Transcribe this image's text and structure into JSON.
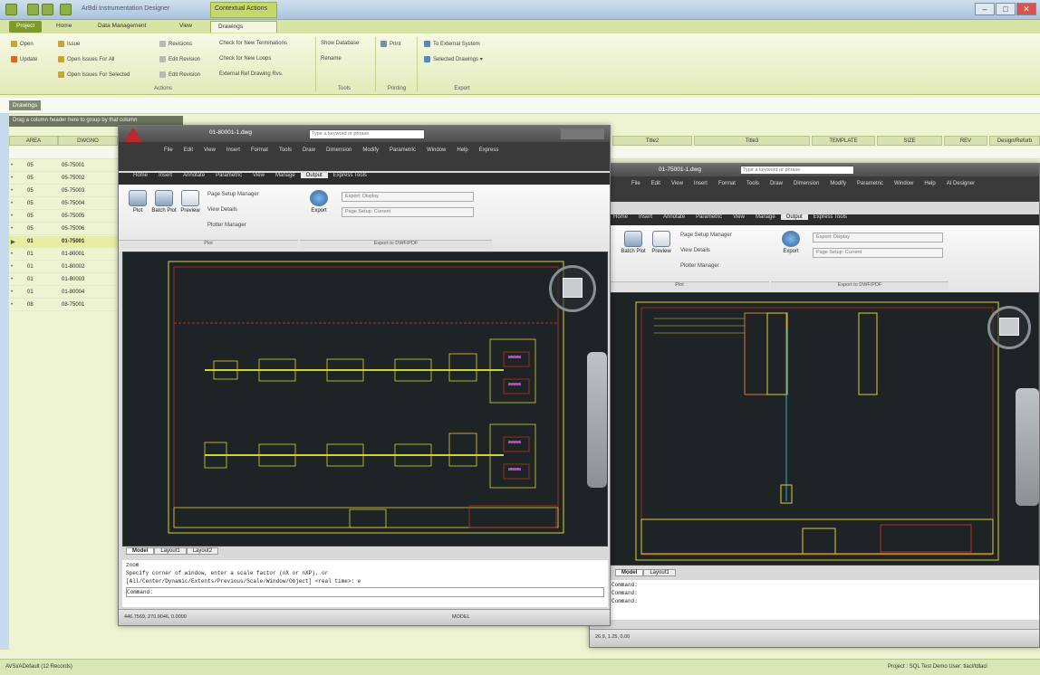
{
  "app": {
    "title": "ArBdi Instrumentation Designer",
    "contextual_tab": "Contextual Actions",
    "minimize": "–",
    "maximize": "□",
    "close": "✕"
  },
  "tabs": [
    "Project",
    "Home",
    "Data Management",
    "View",
    "Drawings"
  ],
  "ribbon": {
    "col1": [
      "Open",
      "Update"
    ],
    "col2": [
      "Issue",
      "Open Issues For All",
      "Open Issues For Selected"
    ],
    "col3": [
      "Revisions",
      "Edit Revision",
      "Edit Revision"
    ],
    "col4": [
      "Check for New Terminations",
      "Check for New Loops",
      "External Ref Drawing Rvs."
    ],
    "col5": [
      "Show Database",
      "Rename"
    ],
    "col6": [
      "Print"
    ],
    "col7": [
      "To External System",
      "Selected Drawings ▾"
    ],
    "groups": [
      "Actions",
      "Tools",
      "Printing",
      "Export"
    ]
  },
  "drawings_tab": "Drawings",
  "group_hint": "Drag a column header here to group by that column",
  "grid": {
    "headers_left": [
      "AREA",
      "DWGNO"
    ],
    "headers_right": [
      "Title2",
      "Title3",
      "TEMPLATE",
      "SIZE",
      "REV",
      "Design/Refurb"
    ],
    "rows": [
      {
        "area": "05",
        "dwg": "05-75001",
        "selected": false
      },
      {
        "area": "05",
        "dwg": "05-75002",
        "selected": false
      },
      {
        "area": "05",
        "dwg": "05-75003",
        "selected": false
      },
      {
        "area": "05",
        "dwg": "05-75004",
        "selected": false
      },
      {
        "area": "05",
        "dwg": "05-75005",
        "selected": false
      },
      {
        "area": "05",
        "dwg": "05-75006",
        "selected": false
      },
      {
        "area": "01",
        "dwg": "01-75001",
        "selected": true
      },
      {
        "area": "01",
        "dwg": "01-80001",
        "selected": false
      },
      {
        "area": "01",
        "dwg": "01-80002",
        "selected": false
      },
      {
        "area": "01",
        "dwg": "01-80003",
        "selected": false
      },
      {
        "area": "01",
        "dwg": "01-80004",
        "selected": false
      },
      {
        "area": "08",
        "dwg": "08-75001",
        "selected": false
      }
    ]
  },
  "cad1": {
    "title": "01-80001-1.dwg",
    "search_placeholder": "Type a keyword or phrase",
    "menus": [
      "File",
      "Edit",
      "View",
      "Insert",
      "Format",
      "Tools",
      "Draw",
      "Dimension",
      "Modify",
      "Parametric",
      "Window",
      "Help",
      "Express"
    ],
    "tabs": [
      "Home",
      "Insert",
      "Annotate",
      "Parametric",
      "View",
      "Manage",
      "Output",
      "Express Tools"
    ],
    "buttons": [
      "Plot",
      "Batch Plot",
      "Preview"
    ],
    "small_buttons": [
      "Page Setup Manager",
      "View Details",
      "Plotter Manager"
    ],
    "export_label": "Export",
    "export_combo": "Export: Display",
    "page_setup_combo": "Page Setup: Current",
    "panel_plot": "Plot",
    "panel_export": "Export to DWF/PDF",
    "layouts": [
      "Model",
      "Layout1",
      "Layout2"
    ],
    "cmd_lines": [
      "Specify corner of window, enter a scale factor (nX or nXP), or",
      "[All/Center/Dynamic/Extents/Previous/Scale/Window/Object] <real time>: e"
    ],
    "cmd_top": "zoom",
    "cmd_prompt": "Command:",
    "coords": "446.7569, 270.9046, 0.0000",
    "model_label": "MODEL"
  },
  "cad2": {
    "title": "01-75001-1.dwg",
    "search_placeholder": "Type a keyword or phrase",
    "menus": [
      "File",
      "Edit",
      "View",
      "Insert",
      "Format",
      "Tools",
      "Draw",
      "Dimension",
      "Modify",
      "Parametric",
      "Window",
      "Help",
      "AI Designer"
    ],
    "tabs": [
      "Home",
      "Insert",
      "Annotate",
      "Parametric",
      "View",
      "Manage",
      "Output",
      "Express Tools"
    ],
    "buttons": [
      "Batch Plot",
      "Preview"
    ],
    "small_buttons": [
      "Page Setup Manager",
      "View Details",
      "Plotter Manager"
    ],
    "export_label": "Export",
    "export_combo": "Export: Display",
    "page_setup_combo": "Page Setup: Current",
    "panel_plot": "Plot",
    "panel_export": "Export to DWF/PDF",
    "layouts": [
      "Model",
      "Layout1"
    ],
    "cmd_lines": [
      "Command:",
      "Command:",
      "Command:"
    ],
    "coords": "26.9, 1.25, 0.00",
    "model_label": "MODEL"
  },
  "statusbar": {
    "left": "AVSi/ADefault (12 Records)",
    "right": "Project : SQL Test Demo    User: tlacl/tdlacl"
  }
}
